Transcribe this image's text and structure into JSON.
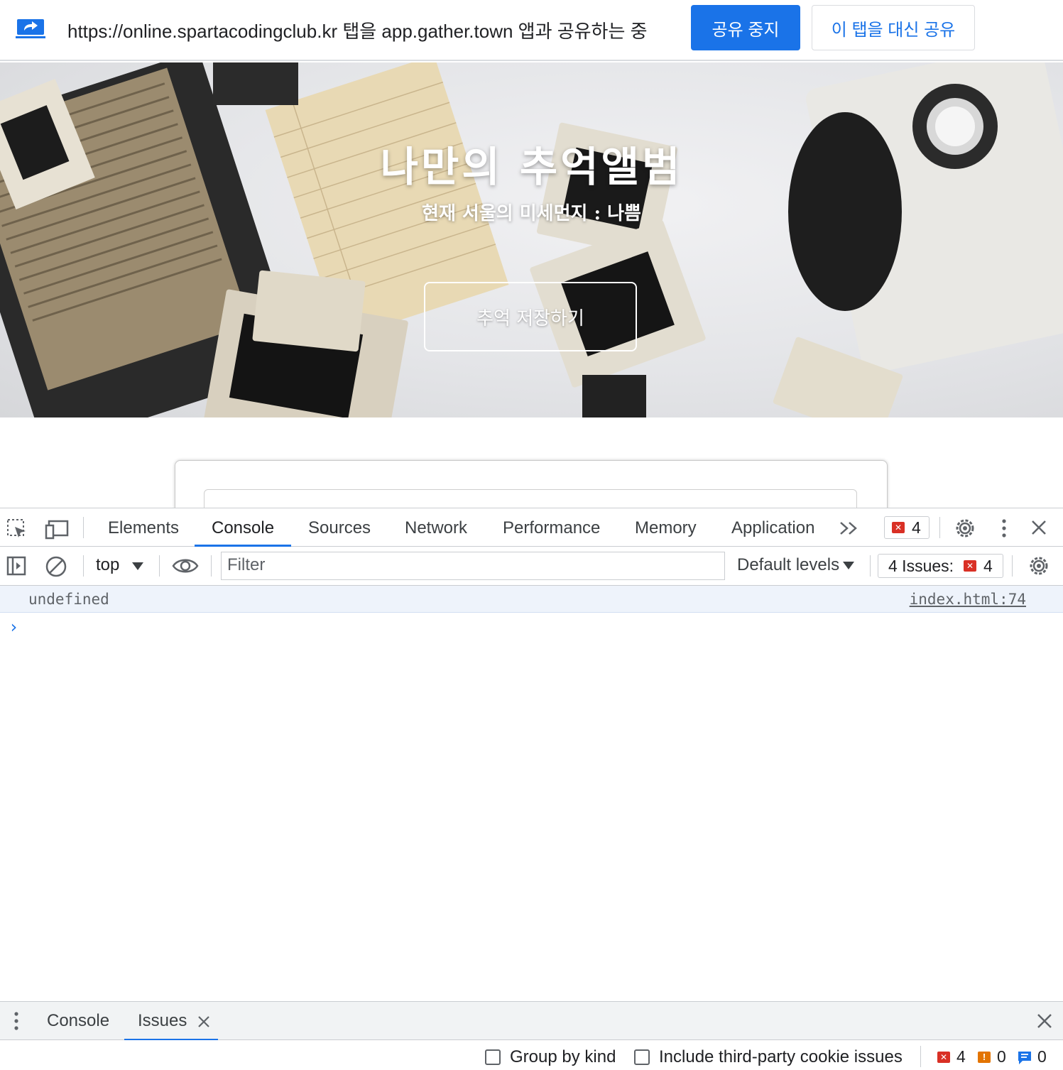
{
  "share_bar": {
    "message": "https://online.spartacodingclub.kr 탭을 app.gather.town 앱과 공유하는 중",
    "stop_label": "공유 중지",
    "share_instead_label": "이 탭을 대신 공유",
    "accent": "#1a73e8"
  },
  "page": {
    "hero_title": "나만의 추억앨범",
    "hero_subtitle": "현재 서울의 미세먼지 : 나쁨",
    "hero_button": "추억 저장하기"
  },
  "devtools": {
    "tabs": [
      "Elements",
      "Console",
      "Sources",
      "Network",
      "Performance",
      "Memory",
      "Application"
    ],
    "active_tab": "Console",
    "error_count": "4",
    "toolbar": {
      "context": "top",
      "filter_placeholder": "Filter",
      "levels": "Default levels",
      "issues_label": "4 Issues:",
      "issues_count": "4"
    },
    "console": {
      "messages": [
        {
          "text": "undefined",
          "source": "index.html:74"
        }
      ],
      "prompt": "›"
    },
    "drawer": {
      "tabs": [
        "Console",
        "Issues"
      ],
      "active_tab": "Issues",
      "group_by_kind": "Group by kind",
      "third_party": "Include third-party cookie issues",
      "counts": {
        "errors": "4",
        "warnings": "0",
        "info": "0"
      }
    }
  }
}
